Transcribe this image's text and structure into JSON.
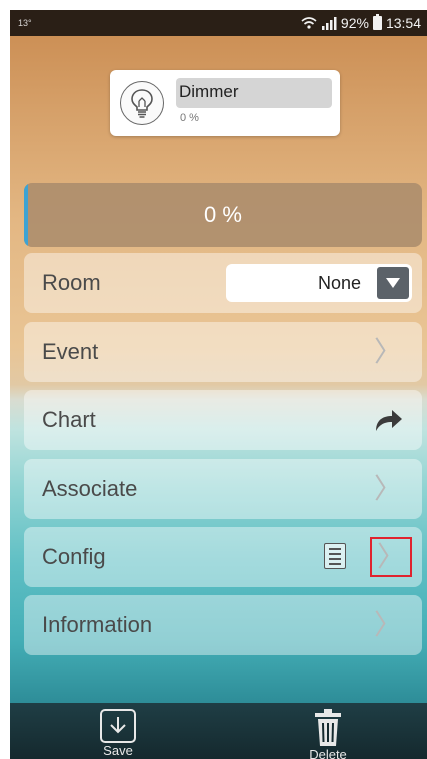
{
  "status_bar": {
    "left_text": "13°",
    "battery": "92%",
    "time": "13:54",
    "icons": [
      "wifi-icon",
      "signal-icon",
      "battery-icon"
    ]
  },
  "device": {
    "name": "Dimmer",
    "level": "0 %",
    "icon": "lightbulb-icon"
  },
  "progress": {
    "label": "0 %",
    "value_percent": 0,
    "fill_color": "#3da3d3"
  },
  "menu": {
    "room": {
      "label": "Room",
      "selected_value": "None",
      "icon": "chevron-down-icon"
    },
    "event": {
      "label": "Event",
      "icon": "chevron-right-icon"
    },
    "chart": {
      "label": "Chart",
      "icon": "share-arrow-icon"
    },
    "associate": {
      "label": "Associate",
      "icon": "chevron-right-icon"
    },
    "config": {
      "label": "Config",
      "icons": [
        "document-icon",
        "chevron-right-icon"
      ],
      "highlight_color": "#e0232e"
    },
    "information": {
      "label": "Information",
      "icon": "chevron-right-icon"
    },
    "chevron_glyph": "〉"
  },
  "toolbar": {
    "save_label": "Save",
    "delete_label": "Delete",
    "save_icon": "save-download-icon",
    "delete_icon": "trash-icon"
  }
}
